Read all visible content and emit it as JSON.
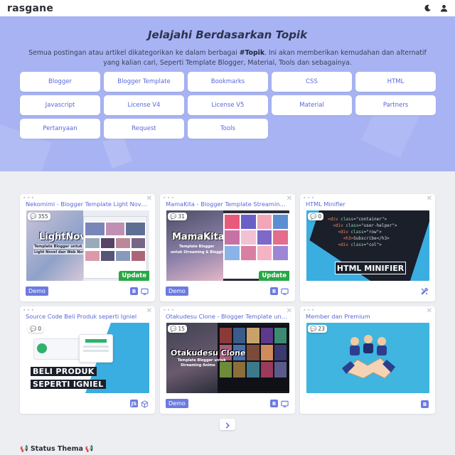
{
  "header": {
    "logo": "rasgane",
    "icons": [
      "moon-icon",
      "user-icon"
    ]
  },
  "hero": {
    "title": "Jelajahi Berdasarkan Topik",
    "desc_before": "Semua postingan atau artikel dikategorikan ke dalam berbagai ",
    "desc_bold": "#Topik",
    "desc_after": ". Ini akan memberikan kemudahan dan alternatif yang kalian cari, Seperti Template Blogger, Material, Tools dan sebagainya.",
    "topics": [
      "Blogger",
      "Blogger Template",
      "Bookmarks",
      "CSS",
      "HTML",
      "Javascript",
      "License V4",
      "License V5",
      "Material",
      "Partners",
      "Pertanyaan",
      "Request",
      "Tools"
    ]
  },
  "cards": [
    {
      "title": "Nekomimi - Blogger Template Light Nove…",
      "comments": "355",
      "badge": "Update",
      "demo": "Demo",
      "thumb_text": [
        "LightNovel",
        "Template Blogger untuk",
        "Light Novel dan Web Novel"
      ],
      "tags": [
        "blogger-icon",
        "monitor-icon"
      ]
    },
    {
      "title": "MamaKita - Blogger Template Streamin…",
      "comments": "31",
      "badge": "Update",
      "demo": "Demo",
      "thumb_text": [
        "MamaKita",
        "Template Blogger",
        "untuk Streaming & Blogging"
      ],
      "tags": [
        "blogger-icon",
        "monitor-icon"
      ]
    },
    {
      "title": "HTML Minifier",
      "comments": "0",
      "badge": "",
      "demo": "",
      "thumb_text": [
        "HTML MINIFIER"
      ],
      "tags": [
        "tools-icon"
      ]
    },
    {
      "title": "Source Code Beli Produk seperti Igniel",
      "comments": "0",
      "badge": "",
      "demo": "",
      "thumb_text": [
        "BELI PRODUK",
        "SEPERTI IGNIEL"
      ],
      "tags": [
        "js-icon",
        "box-icon"
      ]
    },
    {
      "title": "Otakudesu Clone - Blogger Template unt…",
      "comments": "15",
      "badge": "",
      "demo": "Demo",
      "thumb_text": [
        "Otakudesu Clone",
        "Template Blogger untuk",
        "Streaming Anime"
      ],
      "tags": [
        "blogger-icon",
        "monitor-icon"
      ]
    },
    {
      "title": "Member dan Premium",
      "comments": "23",
      "badge": "",
      "demo": "",
      "thumb_text": [],
      "tags": [
        "blogger-icon"
      ]
    }
  ],
  "pager": {
    "next_icon": "chevron-right-icon"
  },
  "status": {
    "label": "Status Thema",
    "icon": "megaphone-icon"
  }
}
